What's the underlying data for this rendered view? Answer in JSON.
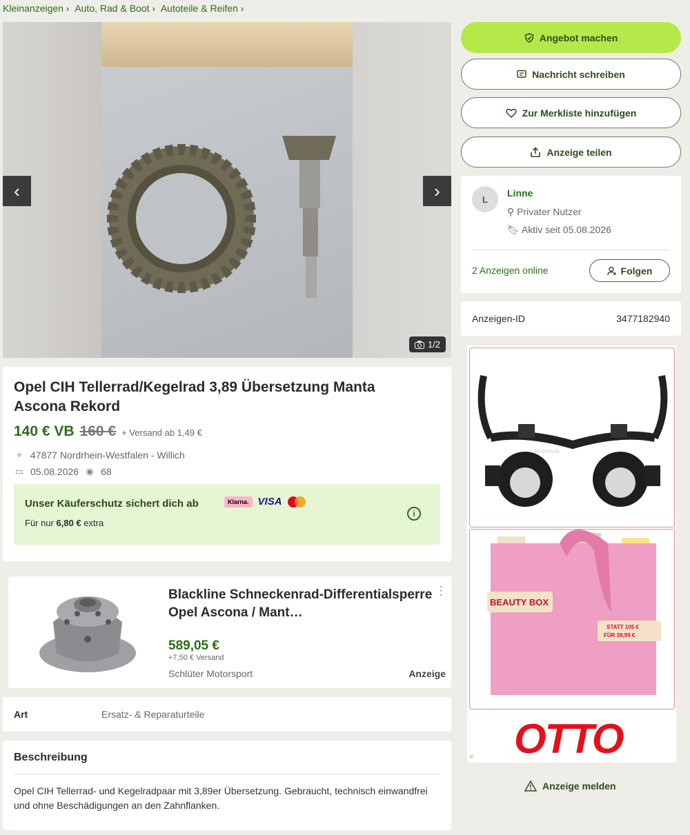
{
  "breadcrumb": [
    "Kleinanzeigen",
    "Auto, Rad & Boot",
    "Autoteile & Reifen"
  ],
  "gallery": {
    "counter": "1/2"
  },
  "listing": {
    "title": "Opel CIH Tellerrad/Kegelrad 3,89 Übersetzung Manta Ascona Rekord",
    "price": "140 € VB",
    "old_price": "160 €",
    "shipping": "+ Versand ab 1,49 €",
    "location": "47877 Nordrhein-Westfalen - Willich",
    "date": "05.08.2026",
    "views": "68"
  },
  "protection": {
    "headline": "Unser Käuferschutz sichert dich ab",
    "prefix": "Für nur",
    "amount": "6,80 €",
    "suffix": "extra",
    "klarna": "Klarna.",
    "visa": "VISA",
    "colors": {
      "bg": "#e6f5d4"
    }
  },
  "sponsored": {
    "title": "Blackline Schneckenrad-Differentialsperre Opel Ascona / Mant…",
    "price": "589,05 €",
    "shipping": "+7,50 € Versand",
    "seller": "Schlüter Motorsport",
    "label": "Anzeige"
  },
  "attributes": {
    "key": "Art",
    "value": "Ersatz- & Reparaturteile"
  },
  "description": {
    "heading": "Beschreibung",
    "text": "Opel CIH Tellerrad- und Kegelradpaar mit 3,89er Übersetzung. Gebraucht, technisch einwandfrei und ohne Beschädigungen an den Zahnflanken."
  },
  "actions": {
    "offer": "Angebot machen",
    "message": "Nachricht schreiben",
    "watchlist": "Zur Merkliste hinzufügen",
    "share": "Anzeige teilen"
  },
  "seller": {
    "initial": "L",
    "name": "Linne",
    "type": "Privater Nutzer",
    "since": "Aktiv seit 05.08.2026",
    "ads_online": "2 Anzeigen online",
    "follow": "Folgen"
  },
  "ad_id": {
    "label": "Anzeigen-ID",
    "value": "3477182940"
  },
  "external_ad": {
    "beauty_box": "BEAUTY BOX",
    "statt": "STATT 105 €",
    "fuer": "FÜR 39,99 €",
    "brand": "OTTO",
    "brand_color": "#e5101a",
    "loupe_brand": "levenhuk"
  },
  "report": "Anzeige melden",
  "colors": {
    "accent": "#b5e94a",
    "link": "#2d6b1a"
  }
}
